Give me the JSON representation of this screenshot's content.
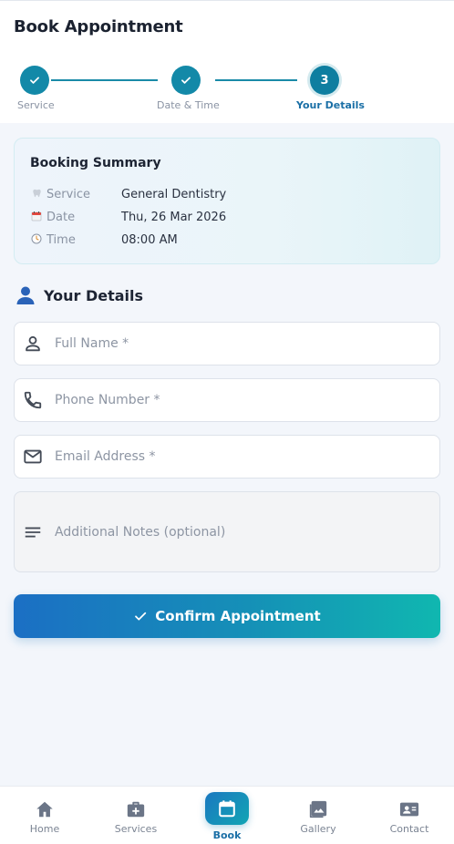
{
  "page": {
    "title": "Book Appointment"
  },
  "stepper": {
    "steps": [
      {
        "label": "Service",
        "state": "done",
        "number": ""
      },
      {
        "label": "Date & Time",
        "state": "done",
        "number": ""
      },
      {
        "label": "Your Details",
        "state": "active",
        "number": "3"
      }
    ]
  },
  "summary": {
    "title": "Booking Summary",
    "rows": [
      {
        "icon": "tooth-icon",
        "key": "Service",
        "value": "General Dentistry"
      },
      {
        "icon": "calendar-icon",
        "key": "Date",
        "value": "Thu, 26 Mar 2026"
      },
      {
        "icon": "clock-icon",
        "key": "Time",
        "value": "08:00 AM"
      }
    ]
  },
  "details": {
    "title": "Your Details",
    "fields": {
      "name": {
        "placeholder": "Full Name *",
        "value": ""
      },
      "phone": {
        "placeholder": "Phone Number *",
        "value": ""
      },
      "email": {
        "placeholder": "Email Address *",
        "value": ""
      },
      "notes": {
        "placeholder": "Additional Notes (optional)",
        "value": ""
      }
    }
  },
  "confirm": {
    "label": "Confirm Appointment"
  },
  "nav": {
    "items": [
      {
        "label": "Home",
        "icon": "home-icon"
      },
      {
        "label": "Services",
        "icon": "medical-bag-icon"
      },
      {
        "label": "Book",
        "icon": "calendar-icon",
        "active": true
      },
      {
        "label": "Gallery",
        "icon": "gallery-icon"
      },
      {
        "label": "Contact",
        "icon": "contact-card-icon"
      }
    ]
  },
  "colors": {
    "primary": "#1389a8",
    "accent_start": "#1b6fc4",
    "accent_end": "#10b7b0",
    "active_text": "#1a6fa6"
  }
}
